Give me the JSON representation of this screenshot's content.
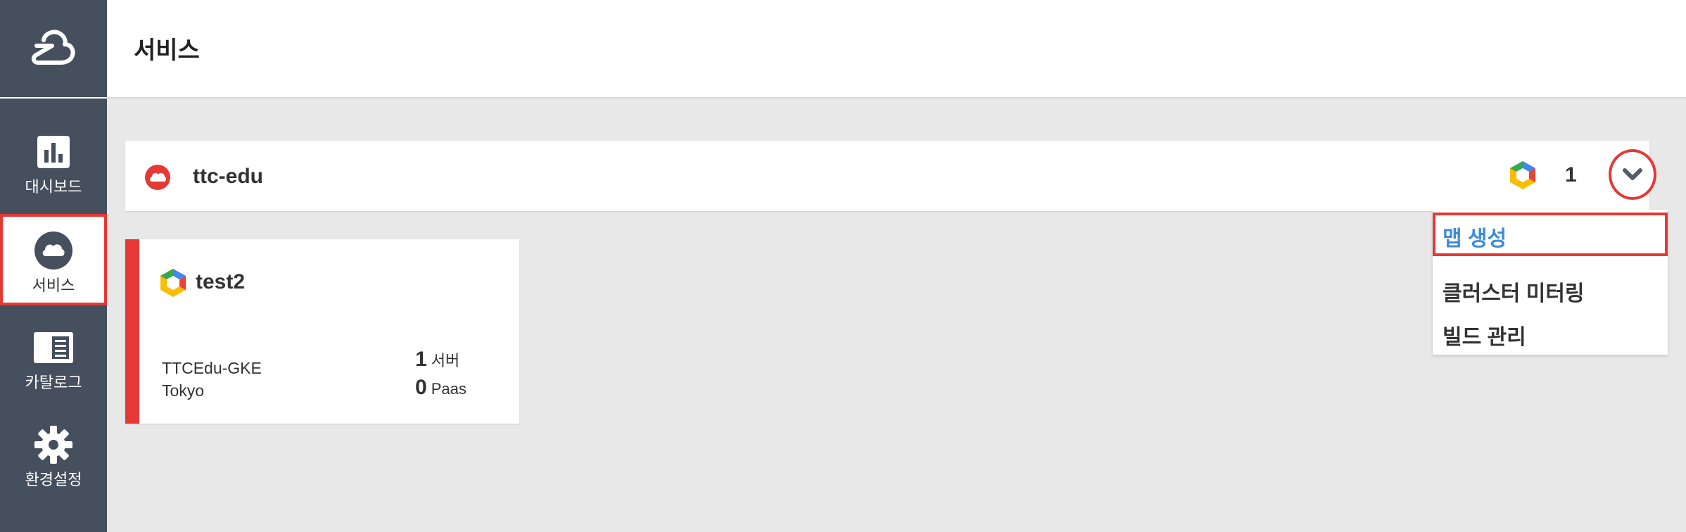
{
  "sidebar": {
    "logo_icon": "cloud-logo-icon",
    "items": [
      {
        "label": "대시보드",
        "icon": "bar-chart-icon"
      },
      {
        "label": "서비스",
        "icon": "cloud-icon",
        "active": true
      },
      {
        "label": "카탈로그",
        "icon": "catalog-icon"
      },
      {
        "label": "환경설정",
        "icon": "gear-icon"
      }
    ]
  },
  "header": {
    "title": "서비스"
  },
  "service": {
    "name": "ttc-edu",
    "provider_icon": "gke-hexagon-icon",
    "count": "1",
    "toggle_icon": "chevron-down-icon"
  },
  "dropdown": {
    "items": [
      {
        "label": "맵 생성"
      },
      {
        "label": "클러스터 미터링"
      },
      {
        "label": "빌드 관리"
      }
    ]
  },
  "cluster_card": {
    "title": "test2",
    "cluster_name": "TTCEdu-GKE",
    "region": "Tokyo",
    "servers_count": "1",
    "servers_label": "서버",
    "paas_count": "0",
    "paas_label": "Paas"
  },
  "colors": {
    "sidebar_bg": "#454f5d",
    "accent_red": "#e53935",
    "link_blue": "#3d8bd8",
    "page_bg": "#e8e8e8"
  }
}
